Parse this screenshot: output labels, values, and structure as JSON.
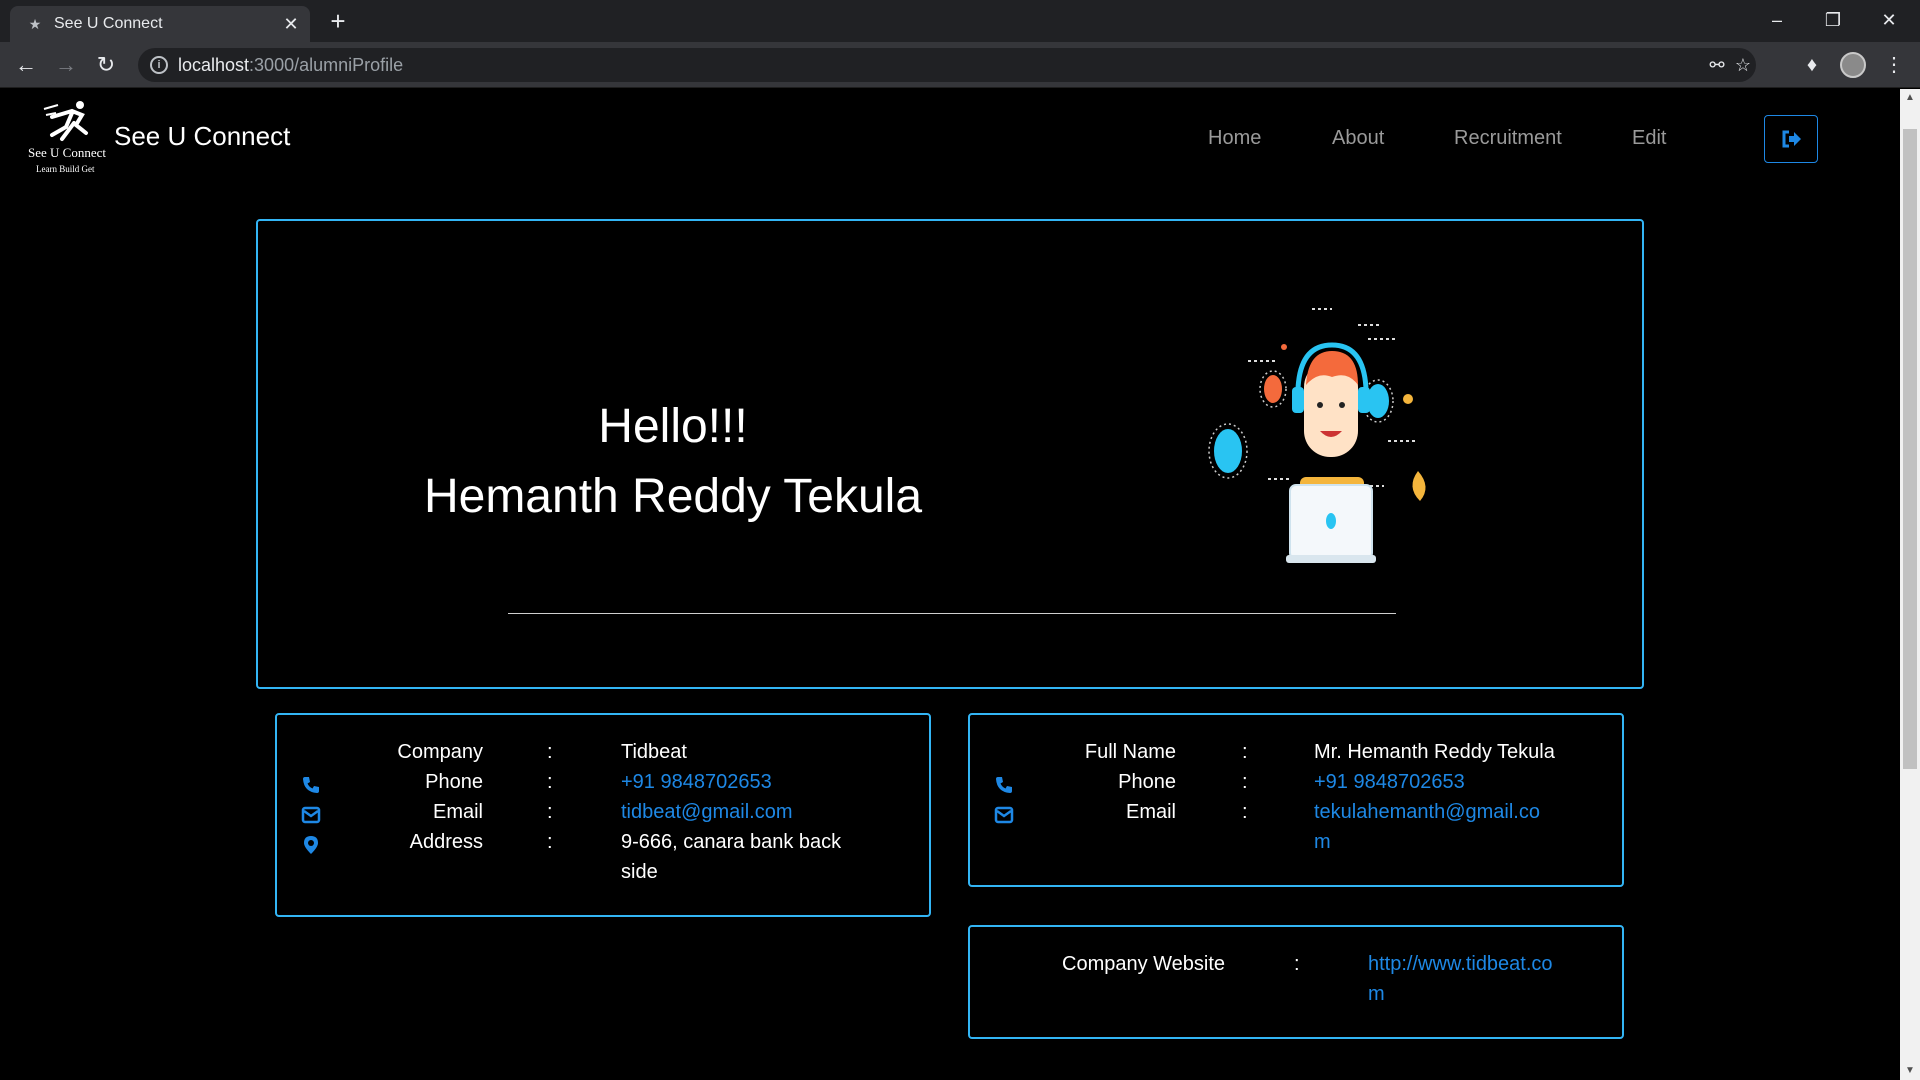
{
  "browser": {
    "tab_title": "See U Connect",
    "url_host": "localhost",
    "url_path": ":3000/alumniProfile"
  },
  "navbar": {
    "brand_title": "See U Connect",
    "logo_name": "See U Connect",
    "logo_tagline": "Learn Build Get",
    "links": [
      "Home",
      "About",
      "Recruitment",
      "Edit"
    ]
  },
  "hero": {
    "greeting": "Hello!!!",
    "name": "Hemanth Reddy Tekula"
  },
  "company_card": {
    "rows": [
      {
        "label": "Company",
        "value": "Tidbeat"
      },
      {
        "label": "Phone",
        "value": "+91 9848702653"
      },
      {
        "label": "Email",
        "value": "tidbeat@gmail.com"
      },
      {
        "label": "Address",
        "value": "9-666, canara bank back side"
      }
    ]
  },
  "personal_card": {
    "rows": [
      {
        "label": "Full Name",
        "value": "Mr. Hemanth Reddy Tekula"
      },
      {
        "label": "Phone",
        "value": "+91 9848702653"
      },
      {
        "label": "Email",
        "value": "tekulahemanth@gmail.com"
      }
    ]
  },
  "website_card": {
    "label": "Company Website",
    "value": "http://www.tidbeat.com"
  },
  "separator": ":",
  "colors": {
    "accent_border": "#33b5f5",
    "link": "#1e88e5",
    "background": "#000000"
  }
}
